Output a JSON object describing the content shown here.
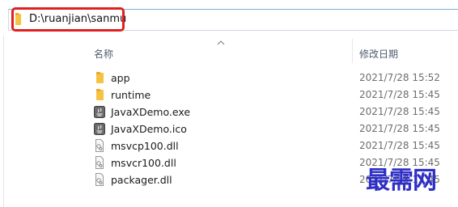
{
  "address_bar": {
    "path": "D:\\ruanjian\\sanmu"
  },
  "columns": {
    "name": "名称",
    "date_modified": "修改日期"
  },
  "files": [
    {
      "name": "app",
      "date": "2021/7/28 15:52",
      "icon": "folder-icon"
    },
    {
      "name": "runtime",
      "date": "2021/7/28 15:45",
      "icon": "folder-icon"
    },
    {
      "name": "JavaXDemo.exe",
      "date": "2021/7/28 15:45",
      "icon": "java-app-icon"
    },
    {
      "name": "JavaXDemo.ico",
      "date": "2021/7/28 15:45",
      "icon": "java-app-icon"
    },
    {
      "name": "msvcp100.dll",
      "date": "2021/7/28 15:45",
      "icon": "dll-file-icon"
    },
    {
      "name": "msvcr100.dll",
      "date": "2021/7/28 15:45",
      "icon": "dll-file-icon"
    },
    {
      "name": "packager.dll",
      "date": "2021/7/28 15:45",
      "icon": "dll-file-icon"
    }
  ],
  "watermark": "最需网",
  "colors": {
    "highlight_box": "#e02020",
    "folder": "#f5c242",
    "watermark": "#2f2fc8"
  }
}
